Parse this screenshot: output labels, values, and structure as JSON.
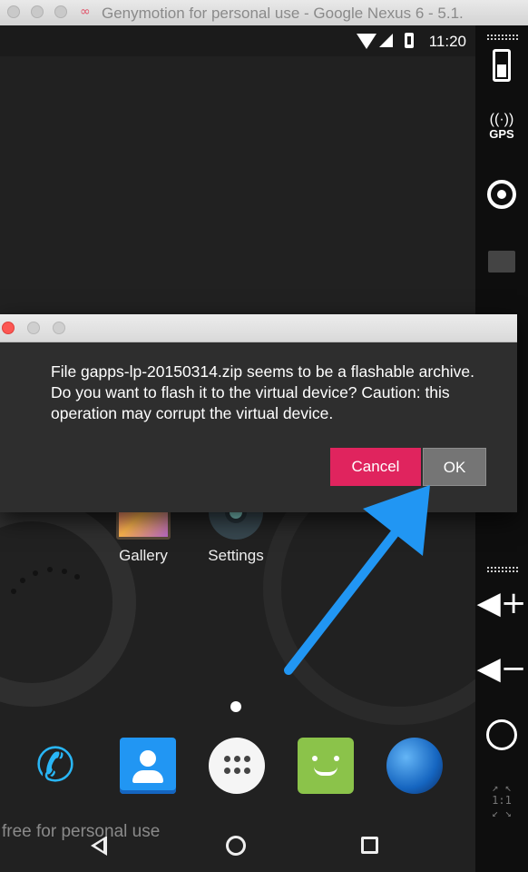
{
  "window": {
    "title": "Genymotion for personal use - Google Nexus 6 - 5.1.",
    "title_icon": "genymotion-logo-icon"
  },
  "status_bar": {
    "time": "11:20"
  },
  "home": {
    "apps": [
      {
        "label": "Gallery",
        "icon": "gallery-icon"
      },
      {
        "label": "Settings",
        "icon": "settings-icon"
      }
    ],
    "dock": [
      "phone-icon",
      "contacts-icon",
      "all-apps-icon",
      "messaging-icon",
      "browser-globe-icon"
    ],
    "watermark": "free for personal use"
  },
  "sidebar": {
    "items": [
      "battery-icon",
      "gps-icon",
      "webcam-icon",
      "media-clapper-icon",
      "volume-up-icon",
      "volume-down-icon",
      "rotate-icon",
      "scale-icon"
    ],
    "gps_label": "GPS",
    "scale_label": "1:1"
  },
  "dialog": {
    "message": "File gapps-lp-20150314.zip seems to be a flashable archive. Do you want to flash it to the virtual device? Caution: this operation may corrupt the virtual device.",
    "cancel_label": "Cancel",
    "ok_label": "OK"
  },
  "colors": {
    "cancel_button": "#e0245e",
    "ok_button": "#757575",
    "annotation_arrow": "#2196f3",
    "dialog_background": "#2e2e2e"
  }
}
